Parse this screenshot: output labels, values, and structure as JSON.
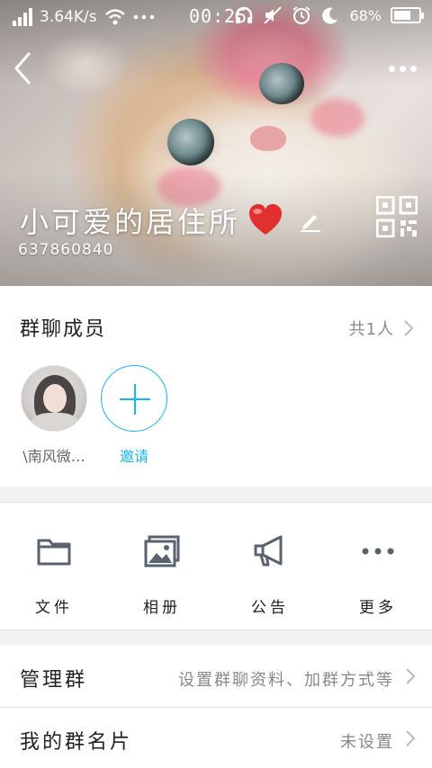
{
  "status_bar": {
    "net_speed": "3.64K/s",
    "time": "00:25",
    "battery_percent": "68%",
    "battery_level": 0.68,
    "icons": [
      "signal-icon",
      "wifi-icon",
      "more-dots-icon",
      "headphone-icon",
      "mute-icon",
      "alarm-icon",
      "night-mode-icon",
      "battery-icon"
    ]
  },
  "header": {
    "group_name": "小可爱的居住所",
    "group_id": "637860840",
    "icons": [
      "back-arrow-icon",
      "more-icon",
      "heart-icon",
      "edit-icon",
      "qr-code-icon"
    ]
  },
  "members": {
    "title": "群聊成员",
    "count_text": "共1人",
    "list": [
      {
        "name": "\\南风微…"
      }
    ],
    "invite_label": "邀请"
  },
  "functions": [
    {
      "label": "文件",
      "icon": "folder-icon"
    },
    {
      "label": "相册",
      "icon": "photo-album-icon"
    },
    {
      "label": "公告",
      "icon": "megaphone-icon"
    },
    {
      "label": "更多",
      "icon": "more-dots-icon"
    }
  ],
  "settings": {
    "manage": {
      "label": "管理群",
      "value": "设置群聊资料、加群方式等"
    },
    "card": {
      "label": "我的群名片",
      "value": "未设置"
    }
  },
  "colors": {
    "accent": "#12b7f5",
    "icon_gray": "#5a6270",
    "heart": "#e0312f"
  }
}
